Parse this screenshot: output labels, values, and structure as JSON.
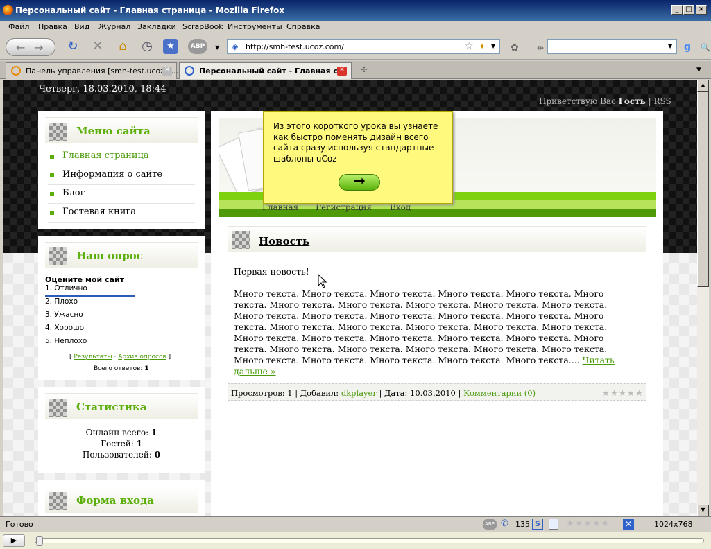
{
  "window": {
    "title": "Персональный сайт - Главная страница - Mozilla Firefox"
  },
  "menu": [
    "Файл",
    "Правка",
    "Вид",
    "Журнал",
    "Закладки",
    "ScrapBook",
    "Инструменты",
    "Справка"
  ],
  "nav": {
    "url": "http://smh-test.ucoz.com/"
  },
  "tabs": [
    {
      "label": "Панель управления [smh-test.ucoz.c..."
    },
    {
      "label": "Персональный сайт - Главная с..."
    }
  ],
  "page": {
    "date": "Четверг, 18.03.2010, 18:44",
    "greeting_prefix": "Приветствую Вас",
    "greeting_user": "Гость",
    "rss": "RSS",
    "menu_block": {
      "title": "Меню сайта",
      "items": [
        "Главная страница",
        "Информация о сайте",
        "Блог",
        "Гостевая книга"
      ]
    },
    "poll_block": {
      "title": "Наш опрос",
      "question": "Оцените мой сайт",
      "options": [
        "1. Отлично",
        "2. Плохо",
        "3. Ужасно",
        "4. Хорошо",
        "5. Неплохо"
      ],
      "results_link": "Результаты",
      "archive_link": "Архив опросов",
      "total_label": "Всего ответов:",
      "total_value": "1"
    },
    "stats_block": {
      "title": "Статистика",
      "online_label": "Онлайн всего:",
      "online": "1",
      "guests_label": "Гостей:",
      "guests": "1",
      "users_label": "Пользователей:",
      "users": "0"
    },
    "login_block": {
      "title": "Форма входа"
    },
    "header_nav": [
      "Главная",
      "Регистрация",
      "Вход"
    ],
    "news": {
      "title": "Новость",
      "first_line": "Первая новость!",
      "lines": [
        "Много текста.  Много текста.  Много текста.  Много текста.  Много текста.  Много",
        "текста.  Много текста.  Много текста.  Много текста.  Много текста.  Много текста.",
        "Много текста.  Много текста.  Много текста.  Много текста.  Много текста.  Много",
        "текста.  Много текста.  Много текста.  Много текста.  Много текста.  Много текста.",
        "Много текста.  Много текста.  Много текста.  Много текста.  Много текста.  Много",
        "текста.  Много текста.  Много текста.  Много текста.  Много текста.  Много текста.",
        "Много текста.  Много текста.  Много текста.  Много текста.  Много текста...."
      ],
      "read_more": "Читать",
      "read_more_2": "дальше »",
      "views_label": "Просмотров:",
      "views": "1",
      "added_label": "Добавил:",
      "author": "dkplayer",
      "date_label": "Дата:",
      "date": "10.03.2010",
      "comments": "Комментарии (0)"
    },
    "tooltip": "Из этого короткого урока вы узнаете как быстро поменять дизайн всего сайта сразу используя стандартные шаблоны uCoz"
  },
  "status": {
    "text": "Готово",
    "count": "135",
    "resolution": "1024x768"
  }
}
